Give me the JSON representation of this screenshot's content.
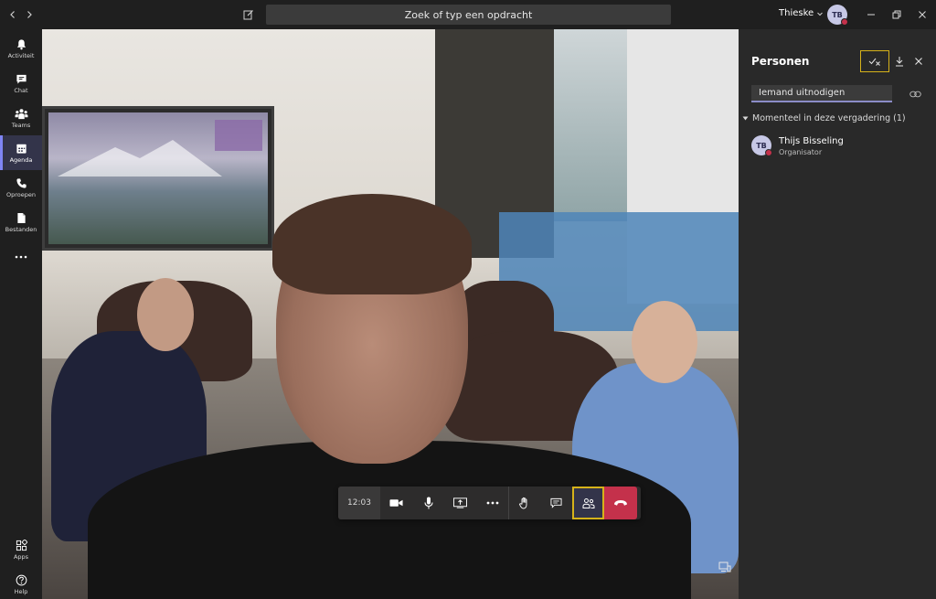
{
  "titlebar": {
    "search_placeholder": "Zoek of typ een opdracht",
    "user_name": "Thieske",
    "avatar_initials": "TB"
  },
  "rail": {
    "items": [
      {
        "label": "Activiteit",
        "icon": "bell-icon"
      },
      {
        "label": "Chat",
        "icon": "chat-icon"
      },
      {
        "label": "Teams",
        "icon": "teams-icon"
      },
      {
        "label": "Agenda",
        "icon": "calendar-icon",
        "active": true
      },
      {
        "label": "Oproepen",
        "icon": "phone-icon"
      },
      {
        "label": "Bestanden",
        "icon": "file-icon"
      }
    ],
    "bottom": [
      {
        "label": "Apps",
        "icon": "apps-icon"
      },
      {
        "label": "Help",
        "icon": "help-icon"
      }
    ]
  },
  "call": {
    "timer": "12:03"
  },
  "panel": {
    "title": "Personen",
    "invite_placeholder": "Iemand uitnodigen",
    "section_label": "Momenteel in deze vergadering (1)",
    "members": [
      {
        "initials": "TB",
        "name": "Thijs Bisseling",
        "role": "Organisator"
      }
    ]
  },
  "colors": {
    "accent": "#7f85f5",
    "hangup": "#c4314b",
    "focus_outline": "#d6b21a",
    "rail_active": "#33344a"
  }
}
